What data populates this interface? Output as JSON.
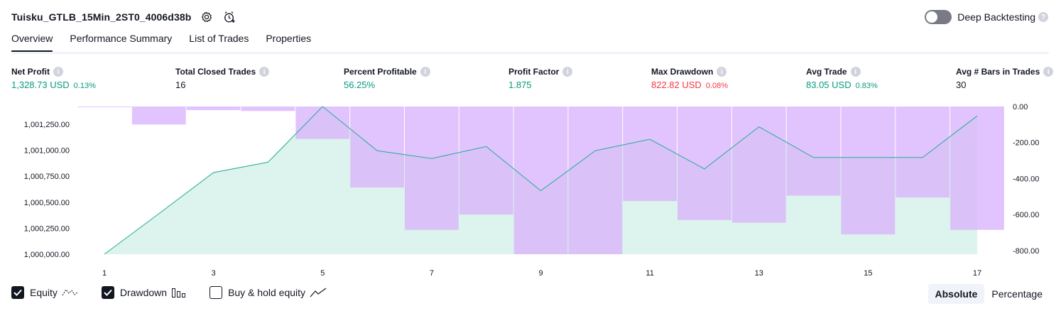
{
  "header": {
    "strategy_name": "Tuisku_GTLB_15Min_2ST0_4006d38b",
    "deep_backtesting_label": "Deep Backtesting",
    "deep_backtesting_on": false
  },
  "tabs": [
    {
      "label": "Overview",
      "active": true
    },
    {
      "label": "Performance Summary",
      "active": false
    },
    {
      "label": "List of Trades",
      "active": false
    },
    {
      "label": "Properties",
      "active": false
    }
  ],
  "metrics": {
    "net_profit": {
      "label": "Net Profit",
      "value": "1,328.73 USD",
      "pct": "0.13%"
    },
    "total_closed_trades": {
      "label": "Total Closed Trades",
      "value": "16"
    },
    "percent_profitable": {
      "label": "Percent Profitable",
      "value": "56.25%"
    },
    "profit_factor": {
      "label": "Profit Factor",
      "value": "1.875"
    },
    "max_drawdown": {
      "label": "Max Drawdown",
      "value": "822.82 USD",
      "pct": "0.08%"
    },
    "avg_trade": {
      "label": "Avg Trade",
      "value": "83.05 USD",
      "pct": "0.83%"
    },
    "avg_bars": {
      "label": "Avg # Bars in Trades",
      "value": "30"
    }
  },
  "legend": {
    "equity": {
      "label": "Equity",
      "checked": true
    },
    "drawdown": {
      "label": "Drawdown",
      "checked": true
    },
    "buy_hold": {
      "label": "Buy & hold equity",
      "checked": false
    }
  },
  "mode": {
    "absolute": "Absolute",
    "percentage": "Percentage",
    "selected": "absolute"
  },
  "colors": {
    "equity_line": "#22ab94",
    "equity_fill": "#d7f1ea",
    "drawdown": "#d9b4fc",
    "positive": "#089981",
    "negative": "#f23645"
  },
  "icons": {
    "settings": "gear-icon",
    "add_alert": "alarm-plus-icon",
    "info": "info-icon",
    "help": "question-icon",
    "check": "check-icon"
  },
  "chart_data": {
    "type": "area",
    "x": [
      1,
      2,
      3,
      4,
      5,
      6,
      7,
      8,
      9,
      10,
      11,
      12,
      13,
      14,
      15,
      16,
      17
    ],
    "x_ticks": [
      "1",
      "3",
      "5",
      "7",
      "9",
      "11",
      "13",
      "15",
      "17"
    ],
    "xlim": [
      1,
      17
    ],
    "series": [
      {
        "name": "Equity",
        "axis": "left",
        "values": [
          1000000.0,
          1000390.0,
          1000785.0,
          1000885.0,
          1001420.0,
          1000995.0,
          1000920.0,
          1001035.0,
          1000610.0,
          1000995.0,
          1001105.0,
          1000820.0,
          1001225.0,
          1000930.0,
          1000930.0,
          1000930.0,
          1001330.0
        ]
      },
      {
        "name": "Drawdown",
        "axis": "right",
        "type": "bar",
        "values": [
          0.0,
          -100.0,
          -20.0,
          -25.0,
          -180.0,
          -450.0,
          -685.0,
          -600.0,
          -820.0,
          -820.0,
          -525.0,
          -630.0,
          -645.0,
          -495.0,
          -710.0,
          -505.0,
          -685.0
        ]
      }
    ],
    "left_axis": {
      "ticks": [
        "1,000,000.00",
        "1,000,250.00",
        "1,000,500.00",
        "1,000,750.00",
        "1,001,000.00",
        "1,001,250.00"
      ],
      "ylim": [
        1000000.0,
        1001420.0
      ]
    },
    "right_axis": {
      "ticks": [
        "0.00",
        "-200.00",
        "-400.00",
        "-600.00",
        "-800.00"
      ],
      "ylim": [
        -820.0,
        0.0
      ]
    },
    "grid": false,
    "legend_position": "bottom-left"
  }
}
